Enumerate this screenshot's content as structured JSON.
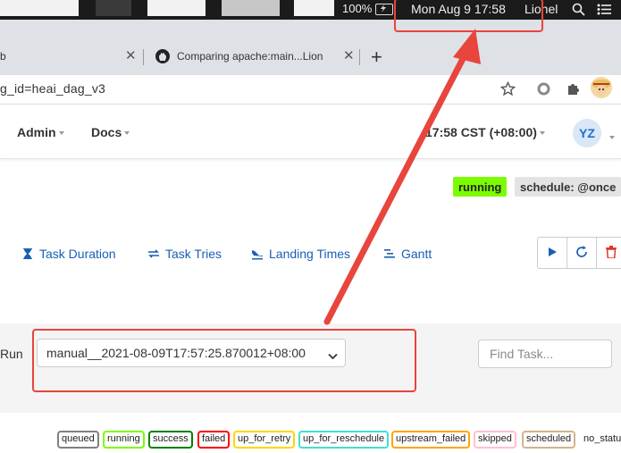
{
  "menubar": {
    "battery_percent": "100%",
    "datetime": "Mon Aug 9  17:58",
    "user": "Lionel"
  },
  "browser": {
    "tabs": [
      {
        "label": "b"
      },
      {
        "label": "Comparing apache:main...Lion"
      }
    ],
    "new_tab_label": "+",
    "url": "g_id=heai_dag_v3"
  },
  "navbar": {
    "items": [
      {
        "label": "Admin"
      },
      {
        "label": "Docs"
      }
    ],
    "clock": "17:58 CST (+08:00)",
    "avatar_initials": "YZ"
  },
  "dag": {
    "state_badge": "running",
    "schedule_badge": "schedule: @once"
  },
  "views": [
    {
      "label": "Task Duration",
      "icon": "hourglass-icon"
    },
    {
      "label": "Task Tries",
      "icon": "retry-arrows-icon"
    },
    {
      "label": "Landing Times",
      "icon": "plane-landing-icon"
    },
    {
      "label": "Gantt",
      "icon": "gantt-icon"
    }
  ],
  "runbar": {
    "run_label": "Run",
    "selected_run": "manual__2021-08-09T17:57:25.870012+08:00",
    "find_task_placeholder": "Find Task..."
  },
  "legend": [
    {
      "label": "queued",
      "color": "#808080"
    },
    {
      "label": "running",
      "color": "#7cfc00"
    },
    {
      "label": "success",
      "color": "#008000"
    },
    {
      "label": "failed",
      "color": "#ff0000"
    },
    {
      "label": "up_for_retry",
      "color": "#ffd700"
    },
    {
      "label": "up_for_reschedule",
      "color": "#40e0d0"
    },
    {
      "label": "upstream_failed",
      "color": "#ffa500"
    },
    {
      "label": "skipped",
      "color": "#ffc0cb"
    },
    {
      "label": "scheduled",
      "color": "#d2b48c"
    },
    {
      "label": "no_status",
      "color": "#ffffff"
    }
  ],
  "colors": {
    "annotation_red": "#e8453c",
    "link_blue": "#1a5fb4",
    "running_green": "#7cfc00"
  }
}
